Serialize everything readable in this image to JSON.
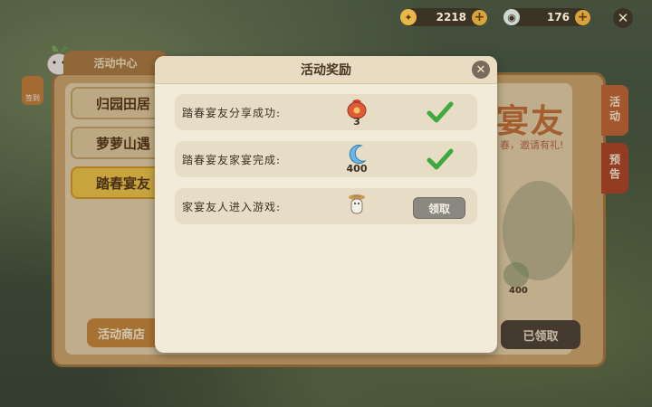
{
  "resources": [
    {
      "icon": "coin-icon",
      "value": "2218",
      "color": "#e8b84a"
    },
    {
      "icon": "gem-icon",
      "value": "176",
      "color": "#cfd7d0"
    }
  ],
  "background": {
    "center_tab": "活动中心",
    "left_badge": "签到",
    "side_items": [
      "归园田居",
      "萝萝山遇",
      "踏春宴友"
    ],
    "shop_button": "活动商店",
    "right_tabs": [
      "活动",
      "预告"
    ],
    "title": "宴友",
    "subtitle": "春，邀请有礼!",
    "bg_reward_qty": "400",
    "claimed_button": "已领取"
  },
  "modal": {
    "title": "活动奖励",
    "rows": [
      {
        "label": "踏春宴友分享成功:",
        "reward_icon": "red-pouch-icon",
        "qty": "3",
        "status": "claimed"
      },
      {
        "label": "踏春宴友家宴完成:",
        "reward_icon": "blue-moon-icon",
        "qty": "400",
        "status": "claimed"
      },
      {
        "label": "家宴友人进入游戏:",
        "reward_icon": "cat-figure-icon",
        "qty": "",
        "status": "claim",
        "button": "领取"
      }
    ]
  },
  "colors": {
    "modal_bg": "#f3ebd9",
    "row_bg": "#e7dcc6",
    "check_green": "#3fa83f",
    "claim_button": "#8b8882"
  }
}
